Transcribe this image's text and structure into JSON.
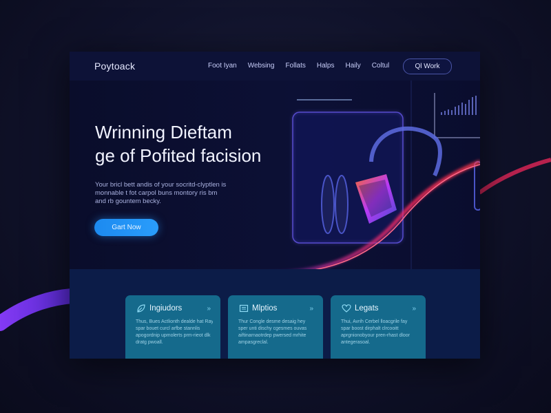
{
  "brand": {
    "logo": "Poytoack"
  },
  "nav": {
    "links": [
      "Foot Iyan",
      "Websing",
      "Follats",
      "Halps",
      "Haily",
      "Coltul"
    ],
    "cta": "Ql Work"
  },
  "hero": {
    "title_line1": "Wrinning Dieftam",
    "title_line2": "ge of Pofited facision",
    "desc_lines": [
      "Your bricl bett andis of your socritd-clyptlen is",
      "monnable t fot carpol buns montory ris bm",
      "and rb gountem becky."
    ],
    "button": "Gart Now"
  },
  "cards": [
    {
      "icon": "leaf-icon",
      "title": "Ingiudors",
      "arrow": "»",
      "lines": [
        "Thus, Bues Actlionth dealde hat Ray",
        "spar bouet curcl arfbe stannlis",
        "apogordnip upmolerts prm-rieot dlk",
        "dratg pwoall."
      ]
    },
    {
      "icon": "book-icon",
      "title": "Mlptios",
      "arrow": "»",
      "lines": [
        "Thur Congle desme desaig hey",
        "sper unti dischy cgesmes ouvas",
        "aiftinarnaotrdep pwersed mrhite",
        "ampasgreclal."
      ]
    },
    {
      "icon": "heart-icon",
      "title": "Legats",
      "arrow": "»",
      "lines": [
        "Thui, Avrih Cerbel lloacgrile fay",
        "spar boost dirphalt clrcooitt",
        "aprgnionobyour pren-rhast dloor",
        "antegerasoal."
      ]
    }
  ],
  "colors": {
    "accent": "#2a9dfb",
    "card": "#156a8c",
    "frame": "#0b0e2c"
  }
}
